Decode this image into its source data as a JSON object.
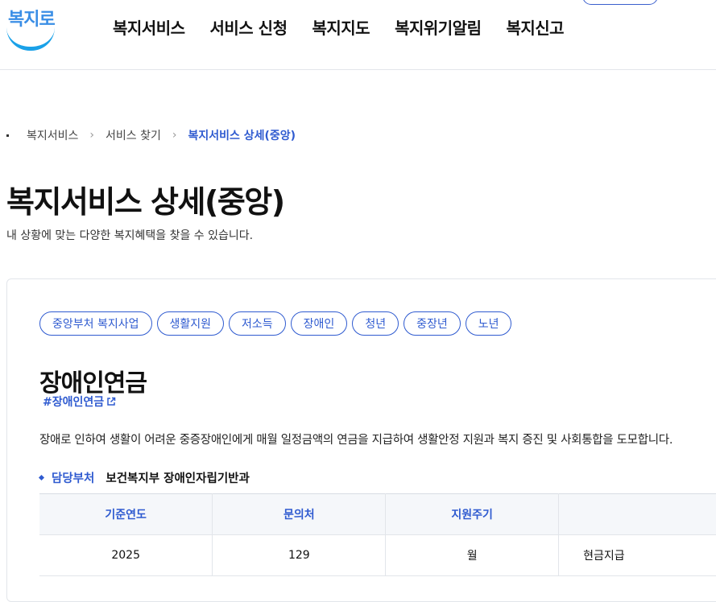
{
  "header": {
    "logo_text": "복지로",
    "nav": [
      "복지서비스",
      "서비스 신청",
      "복지지도",
      "복지위기알림",
      "복지신고"
    ]
  },
  "breadcrumb": [
    "복지서비스",
    "서비스 찾기",
    "복지서비스 상세(중앙)"
  ],
  "page": {
    "title": "복지서비스 상세(중앙)",
    "description": "내 상황에 맞는 다양한 복지혜택을 찾을 수 있습니다."
  },
  "service": {
    "tags": [
      "중앙부처 복지사업",
      "생활지원",
      "저소득",
      "장애인",
      "청년",
      "중장년",
      "노년"
    ],
    "title": "장애인연금",
    "hashtag": "#장애인연금",
    "description": "장애로 인하여 생활이 어려운 중증장애인에게 매월 일정금액의 연금을 지급하여 생활안정 지원과 복지 증진 및 사회통합을 도모합니다.",
    "dept_label": "담당부처",
    "dept_value": "보건복지부 장애인자립기반과",
    "table": {
      "headers": [
        "기준연도",
        "문의처",
        "지원주기",
        ""
      ],
      "row": [
        "2025",
        "129",
        "월",
        "현금지급"
      ]
    }
  },
  "colors": {
    "accent": "#2f5bd0",
    "logo_blue": "#1aa1e8"
  }
}
